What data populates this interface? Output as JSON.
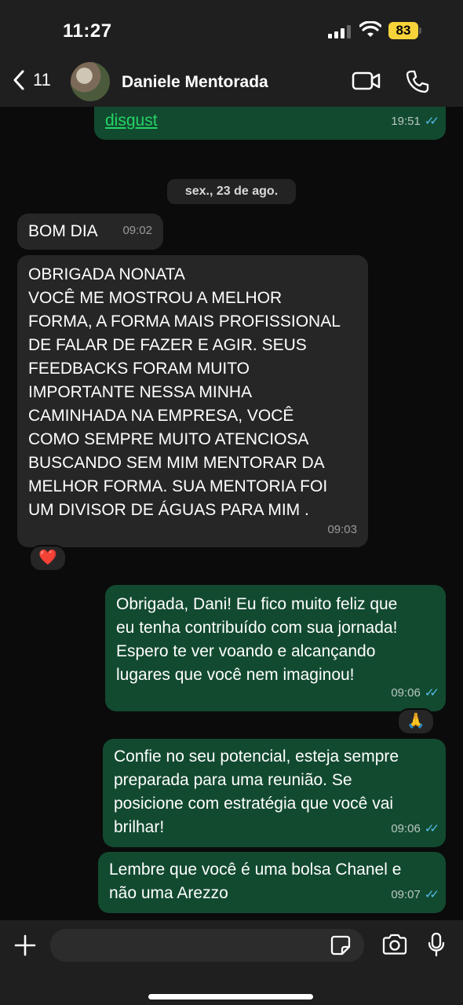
{
  "status_bar": {
    "time": "11:27",
    "battery": "83"
  },
  "header": {
    "back_count": "11",
    "contact_name": "Daniele Mentorada"
  },
  "date_divider": "sex., 23 de ago.",
  "messages": [
    {
      "direction": "out",
      "text": "disgust",
      "time": "19:51",
      "status": "read"
    },
    {
      "direction": "in",
      "text": "BOM DIA",
      "time": "09:02"
    },
    {
      "direction": "in",
      "lines": [
        "OBRIGADA NONATA",
        "VOCÊ ME MOSTROU A MELHOR",
        "FORMA, A FORMA MAIS PROFISSIONAL",
        "DE FALAR DE FAZER E AGIR. SEUS",
        "FEEDBACKS FORAM MUITO",
        "IMPORTANTE NESSA MINHA",
        "CAMINHADA NA EMPRESA, VOCÊ",
        "COMO SEMPRE MUITO ATENCIOSA",
        "BUSCANDO SEM MIM MENTORAR DA",
        "MELHOR FORMA. SUA MENTORIA FOI",
        "UM DIVISOR DE ÁGUAS PARA MIM ."
      ],
      "time": "09:03",
      "reaction": "❤️"
    },
    {
      "direction": "out",
      "lines": [
        "Obrigada, Dani! Eu fico muito feliz que",
        "eu tenha contribuído com sua jornada!",
        "Espero te ver voando e alcançando",
        "lugares que você nem imaginou!"
      ],
      "time": "09:06",
      "status": "read",
      "reaction": "🙏"
    },
    {
      "direction": "out",
      "lines": [
        "Confie no seu potencial, esteja sempre",
        "preparada para uma reunião. Se",
        "posicione com estratégia que você vai",
        "brilhar!"
      ],
      "time": "09:06",
      "status": "read"
    },
    {
      "direction": "out",
      "lines": [
        "Lembre que você é uma bolsa Chanel e",
        "não uma Arezzo"
      ],
      "time": "09:07",
      "status": "read"
    }
  ],
  "composer": {
    "placeholder": ""
  },
  "icons": {
    "back": "chevron-left-icon",
    "video": "video-camera-icon",
    "call": "phone-icon",
    "plus": "plus-icon",
    "sticker": "sticker-icon",
    "camera": "camera-icon",
    "mic": "microphone-icon",
    "read_receipt": "double-check-icon"
  },
  "colors": {
    "outgoing_bubble": "#124a30",
    "incoming_bubble": "#262626",
    "read_ticks": "#53bdeb",
    "battery": "#f7d33a",
    "link": "#25d366"
  }
}
